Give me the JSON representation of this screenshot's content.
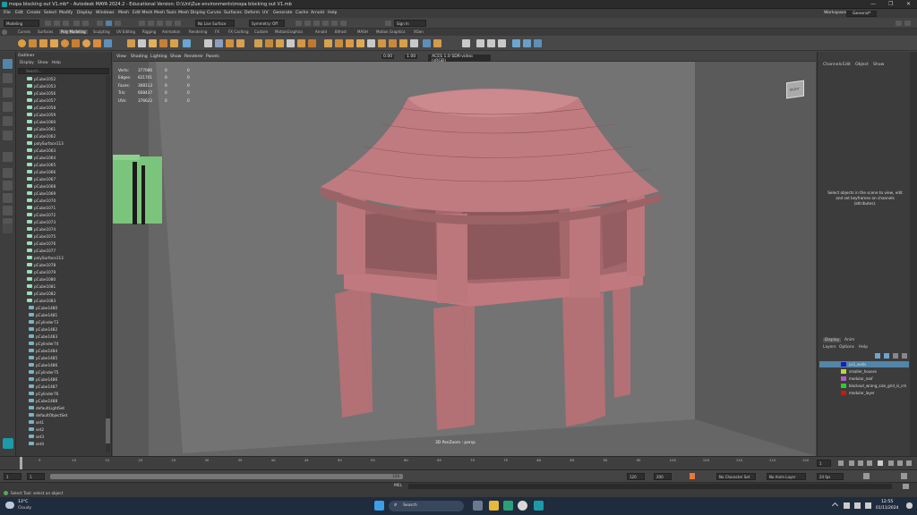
{
  "window": {
    "title": "mopa blocking out V1.mb* - Autodesk MAYA 2024.2 - Educational Version: D:\\Uni\\Zue environments\\mopa blocking out V1.mb",
    "controls": [
      "—",
      "❐",
      "✕"
    ]
  },
  "menubar": {
    "items": [
      "File",
      "Edit",
      "Create",
      "Select",
      "Modify",
      "Display",
      "Windows",
      "Mesh",
      "Edit Mesh",
      "Mesh Tools",
      "Mesh Display",
      "Curves",
      "Surfaces",
      "Deform",
      "UV",
      "Generate",
      "Cache",
      "Arnold",
      "Help"
    ],
    "workspace_label": "Workspace:",
    "workspace_value": "General*"
  },
  "statusline": {
    "mode": "Modeling",
    "live_surface": "No Live Surface",
    "symmetry": "Symmetry: Off",
    "sign_in": "Sign In"
  },
  "shelf_tabs": [
    "Curves",
    "Surfaces",
    "Poly Modeling",
    "Sculpting",
    "UV Editing",
    "Rigging",
    "Animation",
    "Rendering",
    "FX",
    "FX Caching",
    "Custom",
    "MotionGraphics",
    "Arnold",
    "Bifrost",
    "MASH",
    "Motion Graphics",
    "XGen"
  ],
  "shelf_active": "Poly Modeling",
  "outliner": {
    "title": "Outliner",
    "menu": [
      "Display",
      "Show",
      "Help"
    ],
    "search_placeholder": "Search...",
    "items": [
      "pCube1052",
      "pCube1053",
      "pCube1056",
      "pCube1057",
      "pCube1058",
      "pCube1059",
      "pCube1060",
      "pCube1061",
      "pCube1062",
      "polySurface113",
      "pCube1063",
      "pCube1064",
      "pCube1065",
      "pCube1066",
      "pCube1067",
      "pCube1068",
      "pCube1069",
      "pCube1070",
      "pCube1071",
      "pCube1072",
      "pCube1073",
      "pCube1074",
      "pCube1075",
      "pCube1076",
      "pCube1077",
      "polySurface113",
      "pCube1078",
      "pCube1079",
      "pCube1080",
      "pCube1081",
      "pCube1082",
      "pCube1083"
    ],
    "items_lower": [
      "pCube1480",
      "pCube1481",
      "pCylinder73",
      "pCube1482",
      "pCube1483",
      "pCylinder74",
      "pCube1484",
      "pCube1485",
      "pCube1486",
      "pCylinder75",
      "pCube1486",
      "pCube1487",
      "pCylinder76",
      "pCube1488",
      "defaultLightSet",
      "defaultObjectSet",
      "set1",
      "set2",
      "set3",
      "set4"
    ]
  },
  "viewport": {
    "menu": [
      "View",
      "Shading",
      "Lighting",
      "Show",
      "Renderer",
      "Panels"
    ],
    "color_space": "ACES 1.0 SDR-video (sRGB)",
    "exposure": "0.00",
    "gamma": "1.00",
    "hud": [
      {
        "label": "Verts:",
        "v1": "377086",
        "v2": "0",
        "v3": "0"
      },
      {
        "label": "Edges:",
        "v1": "621701",
        "v2": "0",
        "v3": "0"
      },
      {
        "label": "Faces:",
        "v1": "308113",
        "v2": "0",
        "v3": "0"
      },
      {
        "label": "Tris:",
        "v1": "608437",
        "v2": "0",
        "v3": "0"
      },
      {
        "label": "UVs:",
        "v1": "376622",
        "v2": "0",
        "v3": "0"
      }
    ],
    "camera_label": "3D PanZoom : persp",
    "viewcube_label": "RIGHT"
  },
  "channelbox": {
    "tabs": [
      "Channels",
      "Edit",
      "Object",
      "Show"
    ],
    "message": "Select objects in the scene to view, edit and set keyframes on channels (attributes)."
  },
  "layers": {
    "tabs": [
      "Display",
      "Anim"
    ],
    "menu": [
      "Layers",
      "Options",
      "Help"
    ],
    "items": [
      {
        "name": "ps1_walls",
        "color": "#1c1cc8",
        "selected": true
      },
      {
        "name": "smaller_houses",
        "color": "#b8d83a",
        "selected": false
      },
      {
        "name": "modular_roof",
        "color": "#b05bd0",
        "selected": false
      },
      {
        "name": "blockout_wrong_size_grid_is_cm",
        "color": "#28d028",
        "selected": false
      },
      {
        "name": "modular_layer",
        "color": "#c81818",
        "selected": false
      }
    ]
  },
  "timeslider": {
    "ticks": [
      "5",
      "10",
      "15",
      "20",
      "25",
      "30",
      "35",
      "40",
      "45",
      "50",
      "55",
      "60",
      "65",
      "70",
      "75",
      "80",
      "85",
      "90",
      "95",
      "100",
      "105",
      "110",
      "115",
      "120"
    ],
    "current_frame": "1"
  },
  "rangeslider": {
    "start": "1",
    "inner_start": "1",
    "inner_end": "120",
    "end": "120",
    "end2": "200",
    "character_set": "No Character Set",
    "anim_layer": "No Anim Layer",
    "fps": "24 fps"
  },
  "cmdline": {
    "lang": "MEL"
  },
  "helpline": {
    "text": "Select Tool: select an object"
  },
  "taskbar": {
    "weather_temp": "13°C",
    "weather_desc": "Cloudy",
    "search": "Search",
    "time": "12:55",
    "date": "01/11/2024"
  }
}
